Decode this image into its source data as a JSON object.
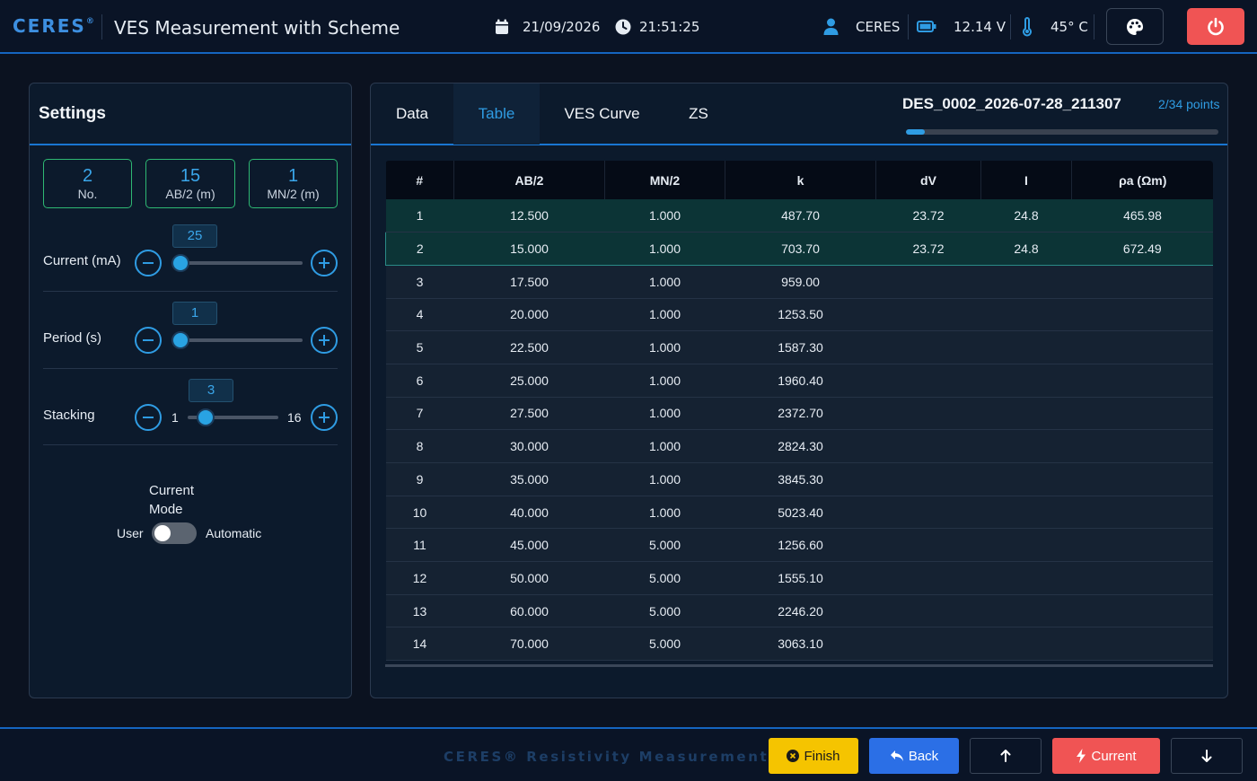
{
  "header": {
    "brand": "CERES",
    "brand_mark": "®",
    "title": "VES Measurement with Scheme",
    "date": "21/09/2026",
    "time": "21:51:25",
    "user": "CERES",
    "voltage": "12.14 V",
    "temperature": "45° C"
  },
  "settings": {
    "title": "Settings",
    "stats": [
      {
        "value": "2",
        "label": "No."
      },
      {
        "value": "15",
        "label": "AB/2 (m)"
      },
      {
        "value": "1",
        "label": "MN/2 (m)"
      }
    ],
    "current": {
      "label": "Current (mA)",
      "value": "25",
      "level": 0.0
    },
    "period": {
      "label": "Period (s)",
      "value": "1",
      "level": 0.0
    },
    "stacking": {
      "label": "Stacking",
      "value": "3",
      "min": "1",
      "max": "16",
      "level": 0.13
    },
    "mode": {
      "title_line1": "Current",
      "title_line2": "Mode",
      "left": "User",
      "right": "Automatic",
      "automatic": false
    }
  },
  "datapanel": {
    "tabs": [
      "Data",
      "Table",
      "VES Curve",
      "ZS"
    ],
    "active_tab": "Table",
    "file_name": "DES_0002_2026-07-28_211307",
    "points": "2/34 points",
    "progress": 0.059,
    "columns": [
      "#",
      "AB/2",
      "MN/2",
      "k",
      "dV",
      "I",
      "ρa (Ωm)"
    ],
    "rows": [
      [
        "1",
        "12.500",
        "1.000",
        "487.70",
        "23.72",
        "24.8",
        "465.98"
      ],
      [
        "2",
        "15.000",
        "1.000",
        "703.70",
        "23.72",
        "24.8",
        "672.49"
      ],
      [
        "3",
        "17.500",
        "1.000",
        "959.00",
        "",
        "",
        ""
      ],
      [
        "4",
        "20.000",
        "1.000",
        "1253.50",
        "",
        "",
        ""
      ],
      [
        "5",
        "22.500",
        "1.000",
        "1587.30",
        "",
        "",
        ""
      ],
      [
        "6",
        "25.000",
        "1.000",
        "1960.40",
        "",
        "",
        ""
      ],
      [
        "7",
        "27.500",
        "1.000",
        "2372.70",
        "",
        "",
        ""
      ],
      [
        "8",
        "30.000",
        "1.000",
        "2824.30",
        "",
        "",
        ""
      ],
      [
        "9",
        "35.000",
        "1.000",
        "3845.30",
        "",
        "",
        ""
      ],
      [
        "10",
        "40.000",
        "1.000",
        "5023.40",
        "",
        "",
        ""
      ],
      [
        "11",
        "45.000",
        "5.000",
        "1256.60",
        "",
        "",
        ""
      ],
      [
        "12",
        "50.000",
        "5.000",
        "1555.10",
        "",
        "",
        ""
      ],
      [
        "13",
        "60.000",
        "5.000",
        "2246.20",
        "",
        "",
        ""
      ],
      [
        "14",
        "70.000",
        "5.000",
        "3063.10",
        "",
        "",
        ""
      ]
    ]
  },
  "footer": {
    "brand": "CERES® Resistivity Measurement System",
    "finish": "Finish",
    "back": "Back",
    "current": "Current"
  }
}
